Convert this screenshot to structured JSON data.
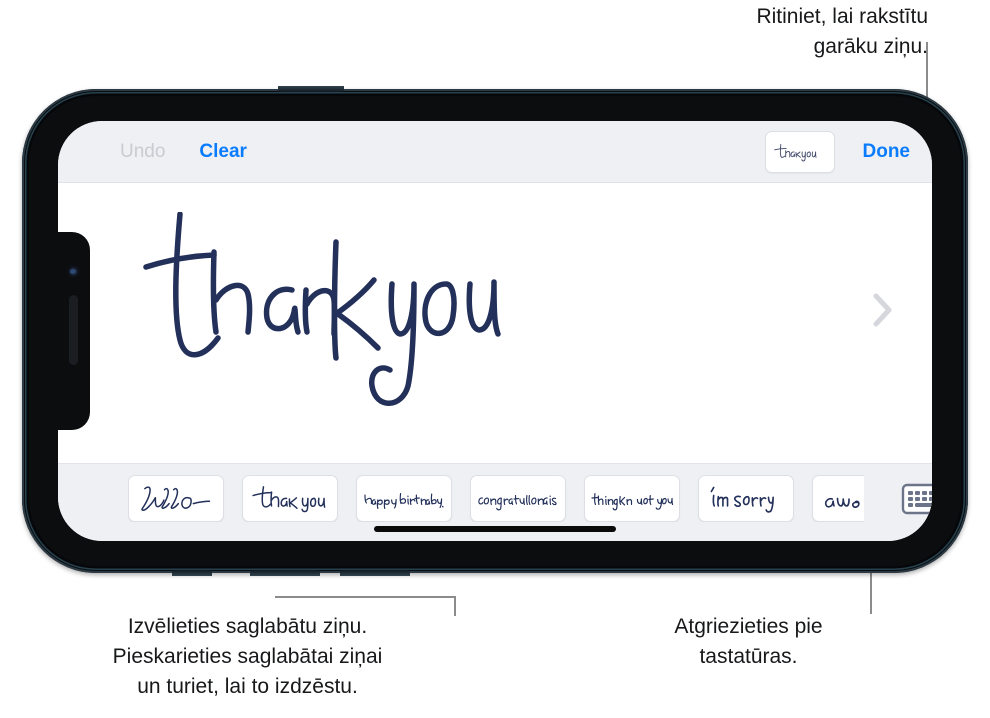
{
  "callouts": {
    "top": "Ritiniet, lai rakstītu\ngarāku ziņu.",
    "bottom_left": "Izvēlieties saglabātu ziņu.\nPieskarieties saglabātai ziņai\nun turiet, lai to izdzēstu.",
    "bottom_right": "Atgriezieties pie\ntastatūras."
  },
  "toolbar": {
    "undo_label": "Undo",
    "clear_label": "Clear",
    "done_label": "Done",
    "thumbnail_text": "thank you",
    "undo_color": "#c9cbd2",
    "accent_color": "#0a7cff",
    "background_color": "#eff0f4"
  },
  "canvas": {
    "handwriting_text": "thank you",
    "ink_color": "#22305a",
    "scroll_hint_icon": "chevron-right-icon"
  },
  "tray": {
    "items": [
      {
        "text": "hello"
      },
      {
        "text": "thank you"
      },
      {
        "text": "happy birthday."
      },
      {
        "text": "congratulations"
      },
      {
        "text": "thinking of you"
      },
      {
        "text": "I'm sorry"
      },
      {
        "text": "awe"
      }
    ],
    "keyboard_icon": "keyboard-icon",
    "background_color": "#eff0f4"
  },
  "device": {
    "body_color": "#0b0d0f",
    "screen_color": "#ffffff",
    "orientation": "landscape"
  }
}
